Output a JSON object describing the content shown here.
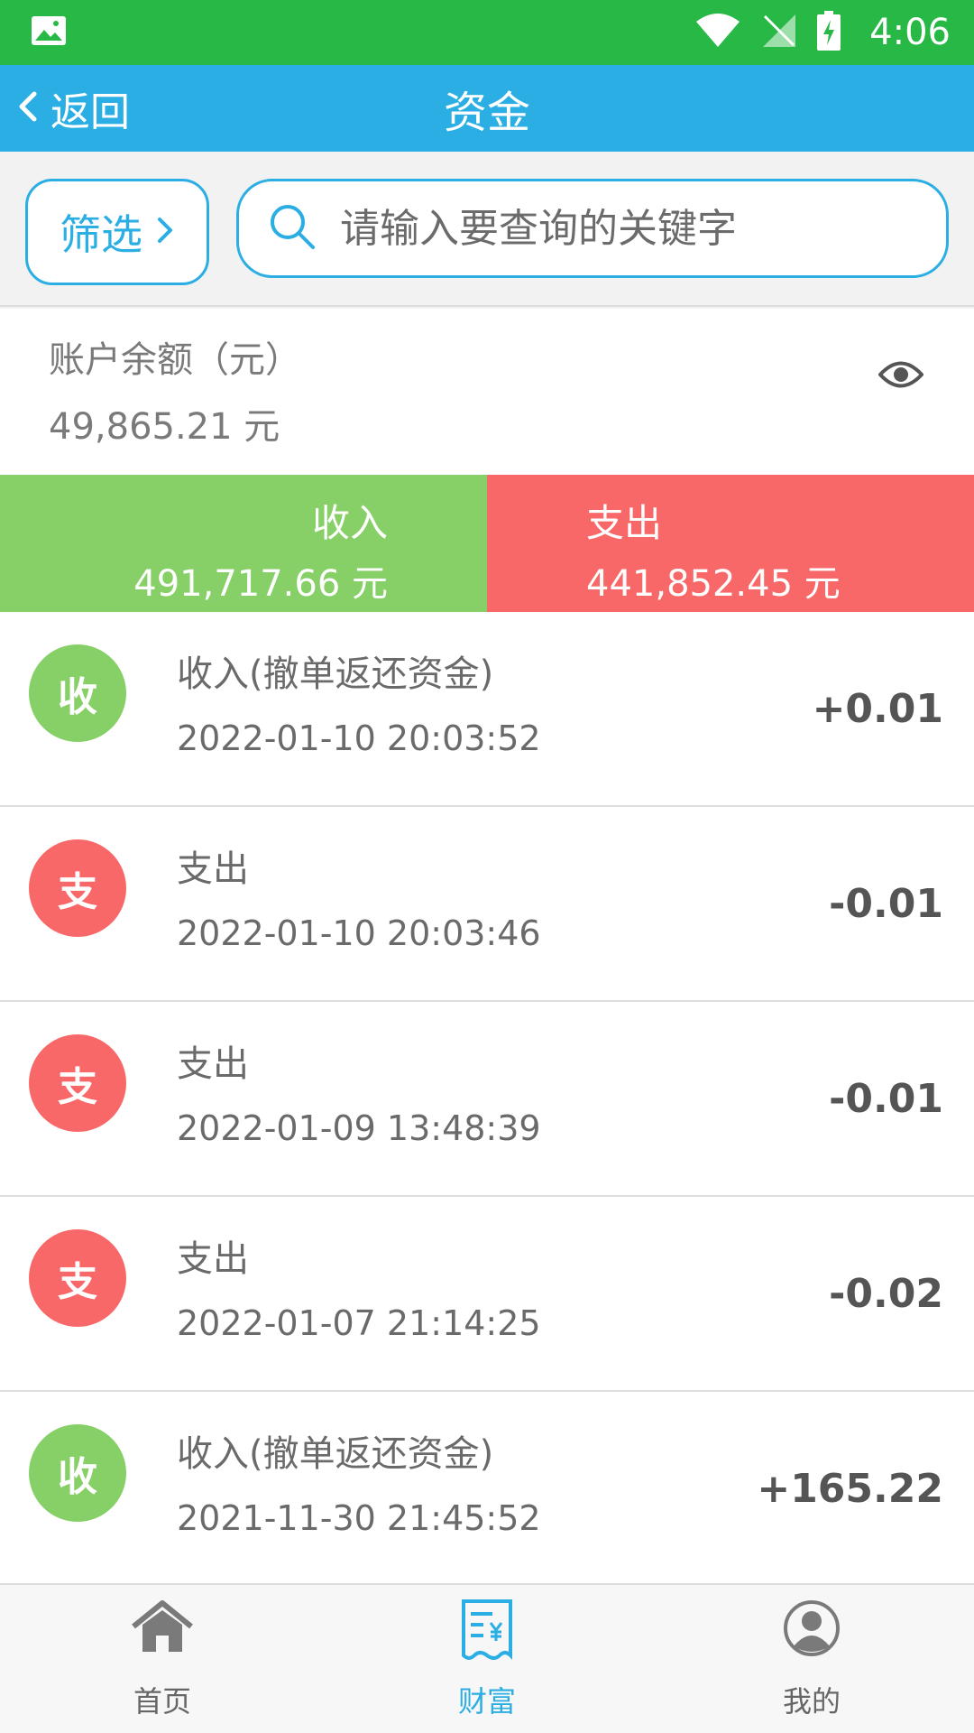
{
  "status_bar": {
    "time": "4:06",
    "icons": [
      "image-icon",
      "wifi-icon",
      "no-signal-icon",
      "battery-charging-icon"
    ],
    "bg_color": "#27b845"
  },
  "nav": {
    "back_label": "返回",
    "title": "资金",
    "bg_color": "#2aaee3"
  },
  "search": {
    "filter_label": "筛选",
    "placeholder": "请输入要查询的关键字",
    "value": ""
  },
  "balance": {
    "label": "账户余额（元）",
    "value": "49,865.21 元"
  },
  "summary": {
    "income_label": "收入",
    "income_value": "491,717.66 元",
    "expense_label": "支出",
    "expense_value": "441,852.45 元",
    "income_color": "#87d068",
    "expense_color": "#f96868"
  },
  "transactions": [
    {
      "badge": "收",
      "type": "income",
      "title": "收入(撤单返还资金)",
      "time": "2022-01-10 20:03:52",
      "amount": "+0.01"
    },
    {
      "badge": "支",
      "type": "expense",
      "title": "支出",
      "time": "2022-01-10 20:03:46",
      "amount": "-0.01"
    },
    {
      "badge": "支",
      "type": "expense",
      "title": "支出",
      "time": "2022-01-09 13:48:39",
      "amount": "-0.01"
    },
    {
      "badge": "支",
      "type": "expense",
      "title": "支出",
      "time": "2022-01-07 21:14:25",
      "amount": "-0.02"
    },
    {
      "badge": "收",
      "type": "income",
      "title": "收入(撤单返还资金)",
      "time": "2021-11-30 21:45:52",
      "amount": "+165.22"
    }
  ],
  "tabs": [
    {
      "label": "首页",
      "icon": "home-icon",
      "active": false
    },
    {
      "label": "财富",
      "icon": "bill-icon",
      "active": true
    },
    {
      "label": "我的",
      "icon": "user-icon",
      "active": false
    }
  ]
}
